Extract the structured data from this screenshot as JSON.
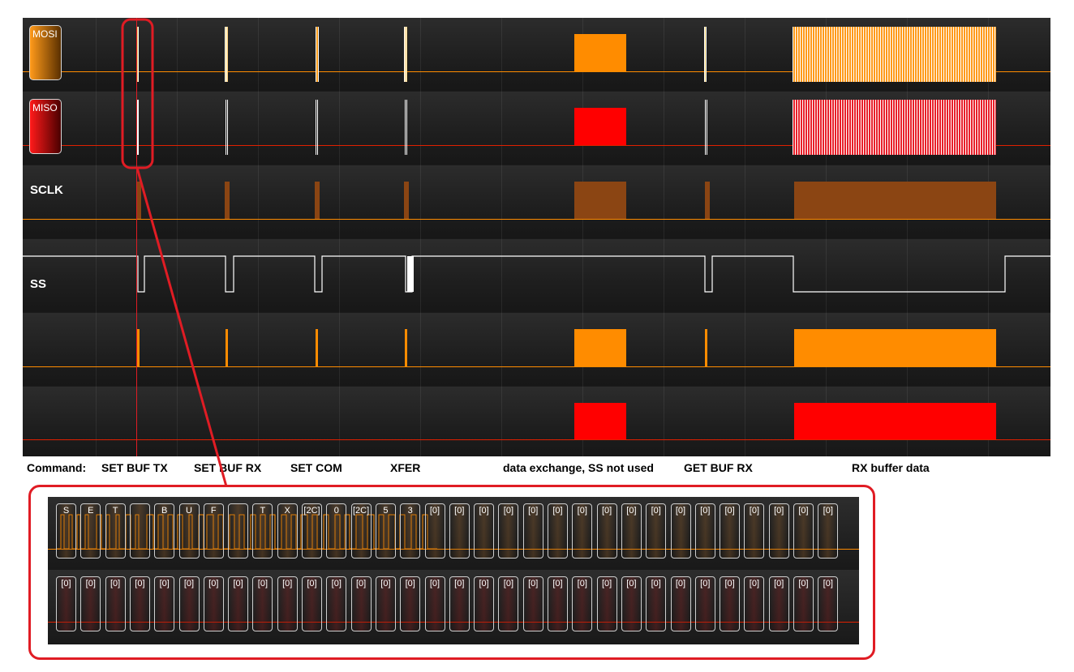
{
  "lanes": {
    "mosi": {
      "label": "MOSI"
    },
    "miso": {
      "label": "MISO"
    },
    "sclk": {
      "label": "SCLK"
    },
    "ss": {
      "label": "SS"
    }
  },
  "colors": {
    "mosi": "#ff8c00",
    "miso": "#ff0000",
    "sclk": "#8b4513",
    "callout": "#e01c24"
  },
  "captions": {
    "command_label": "Command:",
    "set_buf_tx": "SET BUF TX",
    "set_buf_rx": "SET BUF RX",
    "set_com": "SET COM",
    "xfer": "XFER",
    "data_exchange": "data exchange, SS not used",
    "get_buf_rx": "GET BUF RX",
    "rx_buffer_data": "RX buffer data"
  },
  "zoom": {
    "mosi_bytes": [
      "S",
      "E",
      "T",
      "",
      "B",
      "U",
      "F",
      "",
      "T",
      "X",
      "[2C]",
      "0",
      "[2C]",
      "5",
      "3",
      "[0]",
      "[0]",
      "[0]",
      "[0]",
      "[0]",
      "[0]",
      "[0]",
      "[0]",
      "[0]",
      "[0]",
      "[0]",
      "[0]",
      "[0]",
      "[0]",
      "[0]",
      "[0]",
      "[0]"
    ],
    "miso_bytes": [
      "[0]",
      "[0]",
      "[0]",
      "[0]",
      "[0]",
      "[0]",
      "[0]",
      "[0]",
      "[0]",
      "[0]",
      "[0]",
      "[0]",
      "[0]",
      "[0]",
      "[0]",
      "[0]",
      "[0]",
      "[0]",
      "[0]",
      "[0]",
      "[0]",
      "[0]",
      "[0]",
      "[0]",
      "[0]",
      "[0]",
      "[0]",
      "[0]",
      "[0]",
      "[0]",
      "[0]",
      "[0]"
    ]
  },
  "icons": {
    "zoom_callout": "callout-lines"
  }
}
